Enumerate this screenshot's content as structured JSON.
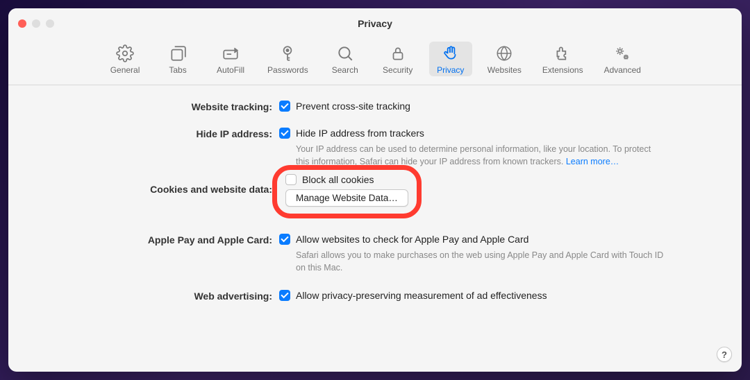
{
  "window": {
    "title": "Privacy"
  },
  "tabs": {
    "general": "General",
    "tabs": "Tabs",
    "autofill": "AutoFill",
    "passwords": "Passwords",
    "search": "Search",
    "security": "Security",
    "privacy": "Privacy",
    "websites": "Websites",
    "extensions": "Extensions",
    "advanced": "Advanced"
  },
  "sections": {
    "tracking": {
      "label": "Website tracking:",
      "option": "Prevent cross-site tracking"
    },
    "hideip": {
      "label": "Hide IP address:",
      "option": "Hide IP address from trackers",
      "desc": "Your IP address can be used to determine personal information, like your location. To protect this information, Safari can hide your IP address from known trackers. ",
      "learn": "Learn more…"
    },
    "cookies": {
      "label": "Cookies and website data:",
      "block": "Block all cookies",
      "manage": "Manage Website Data…"
    },
    "applepay": {
      "label": "Apple Pay and Apple Card:",
      "option": "Allow websites to check for Apple Pay and Apple Card",
      "desc": "Safari allows you to make purchases on the web using Apple Pay and Apple Card with Touch ID on this Mac."
    },
    "webad": {
      "label": "Web advertising:",
      "option": "Allow privacy-preserving measurement of ad effectiveness"
    }
  },
  "help": "?"
}
